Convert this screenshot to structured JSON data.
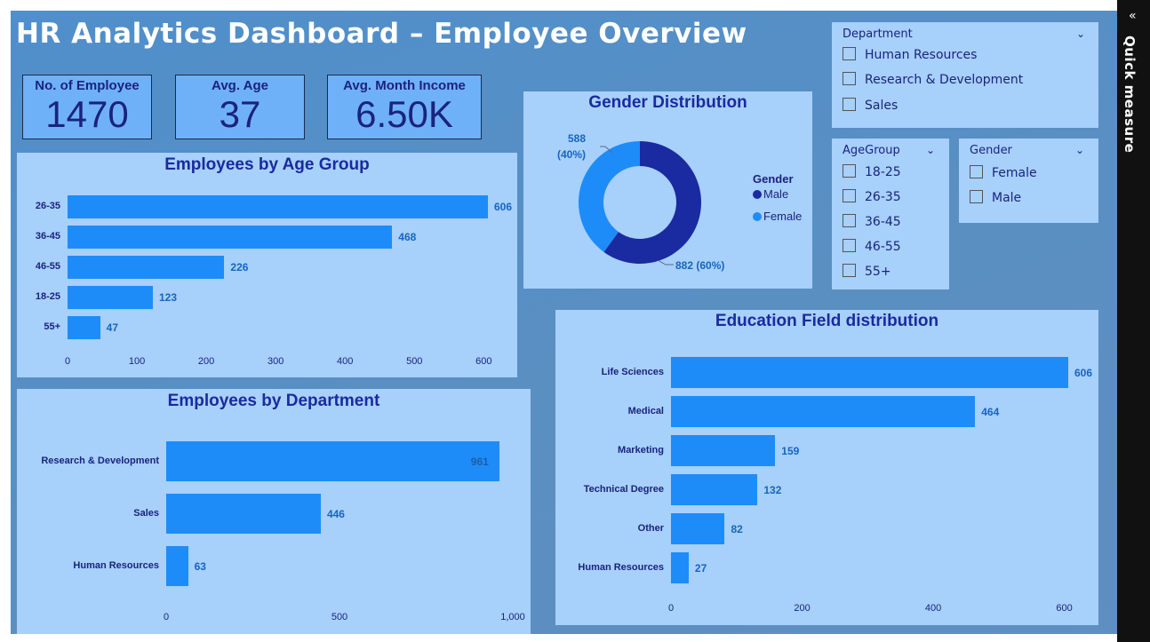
{
  "title": "HR Analytics Dashboard – Employee Overview",
  "kpis": [
    {
      "label": "No. of Employee",
      "value": "1470"
    },
    {
      "label": "Avg. Age",
      "value": "37"
    },
    {
      "label": "Avg. Month Income",
      "value": "6.50K"
    }
  ],
  "quick_measure": "Quick measure",
  "slicers": {
    "department": {
      "header": "Department",
      "options": [
        "Human Resources",
        "Research & Development",
        "Sales"
      ]
    },
    "agegroup": {
      "header": "AgeGroup",
      "options": [
        "18-25",
        "26-35",
        "36-45",
        "46-55",
        "55+"
      ]
    },
    "gender": {
      "header": "Gender",
      "options": [
        "Female",
        "Male"
      ]
    }
  },
  "colors": {
    "bar": "#1d8cf8",
    "male": "#1a2aa0",
    "female": "#1d8cf8",
    "panel": "#a7d0fb",
    "title_text": "#1a2aa0"
  },
  "chart_data": [
    {
      "id": "age",
      "type": "bar",
      "orientation": "horizontal",
      "title": "Employees by Age Group",
      "categories": [
        "26-35",
        "36-45",
        "46-55",
        "18-25",
        "55+"
      ],
      "values": [
        606,
        468,
        226,
        123,
        47
      ],
      "xticks": [
        "0",
        "100",
        "200",
        "300",
        "400",
        "500",
        "600"
      ],
      "xlim": [
        0,
        606
      ]
    },
    {
      "id": "dept",
      "type": "bar",
      "orientation": "horizontal",
      "title": "Employees by Department",
      "categories": [
        "Research & Development",
        "Sales",
        "Human Resources"
      ],
      "values": [
        961,
        446,
        63
      ],
      "xticks": [
        "0",
        "500",
        "1,000"
      ],
      "xlim": [
        0,
        1000
      ]
    },
    {
      "id": "edu",
      "type": "bar",
      "orientation": "horizontal",
      "title": "Education Field distribution",
      "categories": [
        "Life Sciences",
        "Medical",
        "Marketing",
        "Technical Degree",
        "Other",
        "Human Resources"
      ],
      "values": [
        606,
        464,
        159,
        132,
        82,
        27
      ],
      "xticks": [
        "0",
        "200",
        "400",
        "600"
      ],
      "xlim": [
        0,
        606
      ]
    },
    {
      "id": "gender",
      "type": "pie",
      "title": "Gender Distribution",
      "legend_title": "Gender",
      "slices": [
        {
          "name": "Male",
          "value": 882,
          "label": "882 (60%)"
        },
        {
          "name": "Female",
          "value": 588,
          "label": "588 (40%)"
        }
      ]
    }
  ]
}
